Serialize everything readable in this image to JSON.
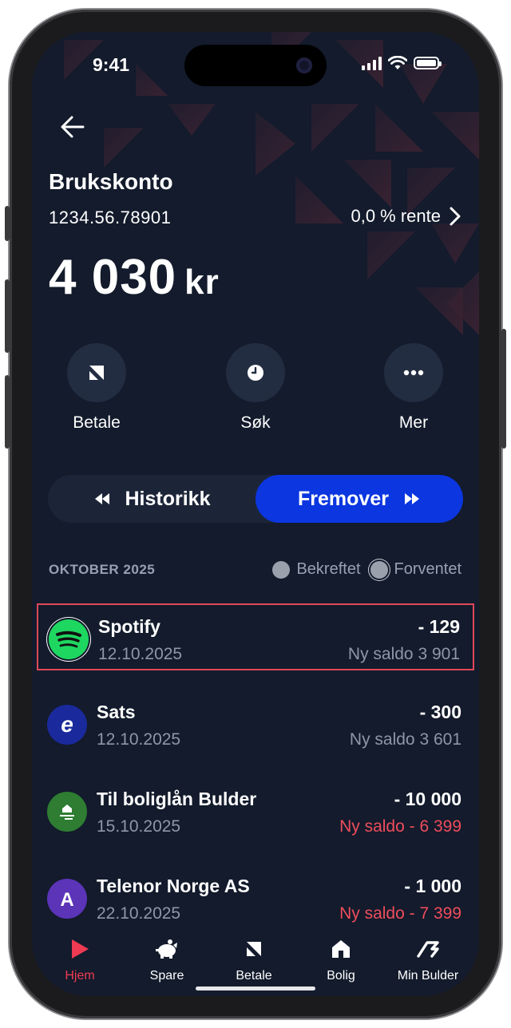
{
  "status_bar": {
    "time": "9:41"
  },
  "account": {
    "name": "Brukskonto",
    "number": "1234.56.78901",
    "rate_label": "0,0 % rente",
    "balance_amount": "4 030",
    "balance_unit": "kr"
  },
  "actions": [
    {
      "label": "Betale",
      "icon": "pay-arrow-icon"
    },
    {
      "label": "Søk",
      "icon": "clock-icon"
    },
    {
      "label": "Mer",
      "icon": "more-dots-icon"
    }
  ],
  "segments": {
    "history_label": "Historikk",
    "upcoming_label": "Fremover",
    "selected": "Fremover"
  },
  "list_header": {
    "month": "OKTOBER 2025",
    "legend_confirmed": "Bekreftet",
    "legend_expected": "Forventet"
  },
  "transactions": [
    {
      "name": "Spotify",
      "date": "12.10.2025",
      "amount": "- 129",
      "saldo": "Ny saldo 3 901",
      "saldo_negative": false,
      "logo": "spotify-logo-icon",
      "highlighted": true
    },
    {
      "name": "Sats",
      "date": "12.10.2025",
      "amount": "- 300",
      "saldo": "Ny saldo 3 601",
      "saldo_negative": false,
      "logo": "sats-logo-icon",
      "highlighted": false
    },
    {
      "name": "Til boliglån Bulder",
      "date": "15.10.2025",
      "amount": "- 10 000",
      "saldo": "Ny saldo - 6 399",
      "saldo_negative": true,
      "logo": "bulder-house-logo-icon",
      "highlighted": false
    },
    {
      "name": "Telenor Norge AS",
      "date": "22.10.2025",
      "amount": "- 1 000",
      "saldo": "Ny saldo - 7 399",
      "saldo_negative": true,
      "logo": "letter-a-logo-icon",
      "highlighted": false
    }
  ],
  "tabbar": [
    {
      "label": "Hjem",
      "icon": "play-icon",
      "active": true
    },
    {
      "label": "Spare",
      "icon": "piggy-bank-icon",
      "active": false
    },
    {
      "label": "Betale",
      "icon": "pay-arrow-icon",
      "active": false
    },
    {
      "label": "Bolig",
      "icon": "house-icon",
      "active": false
    },
    {
      "label": "Min Bulder",
      "icon": "bulder-logo-icon",
      "active": false
    }
  ],
  "colors": {
    "background": "#131b2c",
    "accent_blue": "#0b36e0",
    "negative_red": "#ee4d5c",
    "highlight_border": "#e0485a",
    "active_tab": "#ee3a52",
    "spotify_green": "#1ed760",
    "sats_blue": "#1a2a9c",
    "bulder_green": "#2e7d32",
    "telenor_purple": "#5b34b8"
  }
}
